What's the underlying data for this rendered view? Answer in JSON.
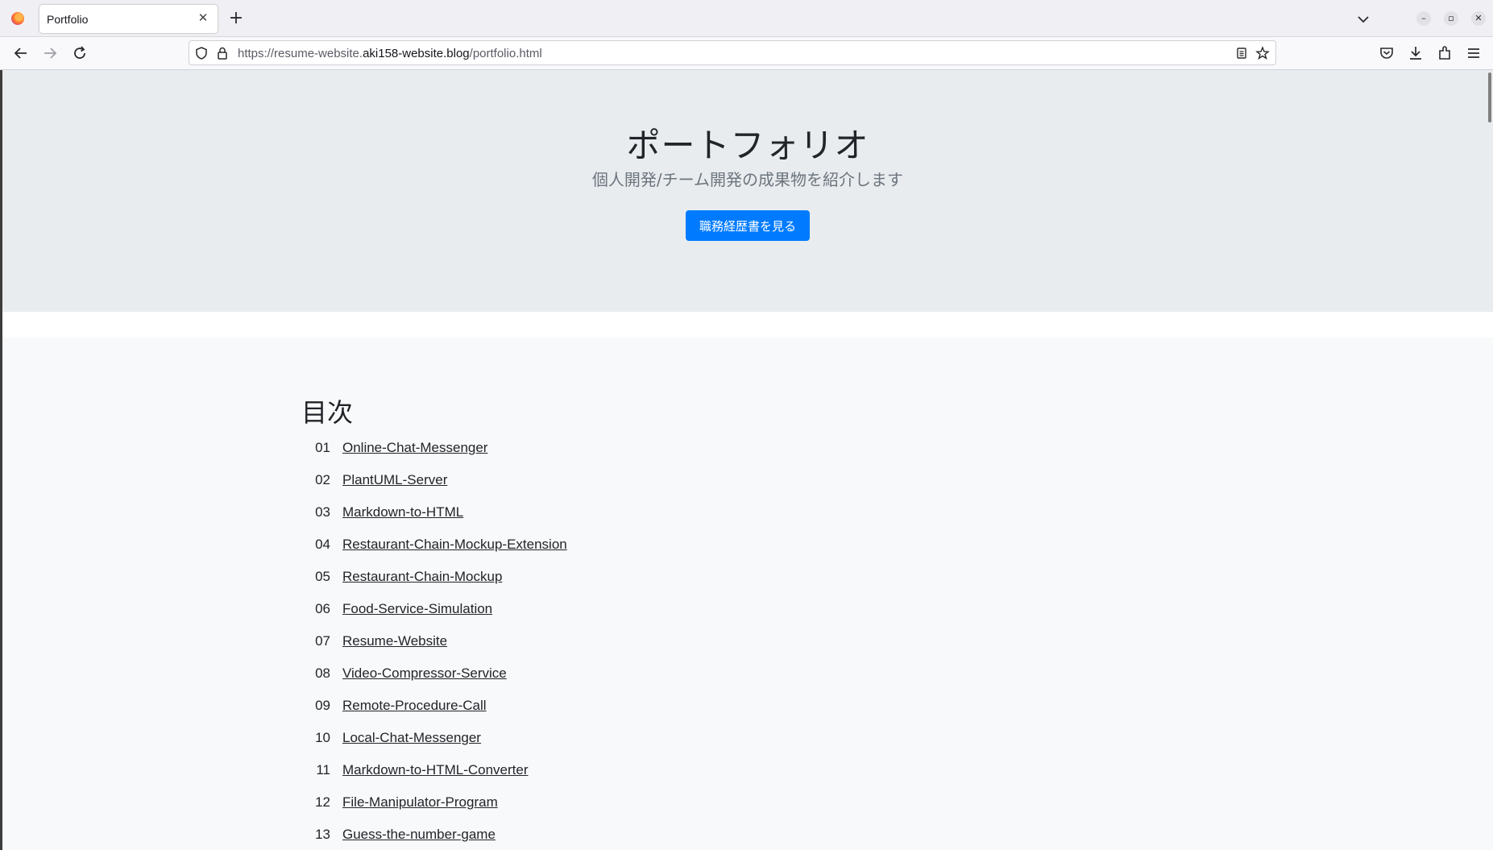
{
  "browser": {
    "tab_title": "Portfolio",
    "url_prefix": "https://resume-website.",
    "url_host": "aki158-website.blog",
    "url_path": "/portfolio.html",
    "icons": [
      "firefox-icon",
      "close-icon",
      "plus-icon",
      "chevron-down-icon",
      "minimize-icon",
      "restore-icon",
      "window-close-icon",
      "back-arrow-icon",
      "forward-arrow-icon",
      "reload-icon",
      "shield-icon",
      "lock-icon",
      "reader-view-icon",
      "bookmark-star-icon",
      "pocket-icon",
      "download-icon",
      "extensions-icon",
      "hamburger-menu-icon"
    ]
  },
  "hero": {
    "title": "ポートフォリオ",
    "subtitle": "個人開発/チーム開発の成果物を紹介します",
    "button_label": "職務経歴書を見る",
    "button_color": "#007bff"
  },
  "toc": {
    "heading": "目次",
    "items": [
      {
        "num": "01",
        "label": "Online-Chat-Messenger"
      },
      {
        "num": "02",
        "label": "PlantUML-Server"
      },
      {
        "num": "03",
        "label": "Markdown-to-HTML"
      },
      {
        "num": "04",
        "label": "Restaurant-Chain-Mockup-Extension"
      },
      {
        "num": "05",
        "label": "Restaurant-Chain-Mockup"
      },
      {
        "num": "06",
        "label": "Food-Service-Simulation"
      },
      {
        "num": "07",
        "label": "Resume-Website"
      },
      {
        "num": "08",
        "label": "Video-Compressor-Service"
      },
      {
        "num": "09",
        "label": "Remote-Procedure-Call"
      },
      {
        "num": "10",
        "label": "Local-Chat-Messenger"
      },
      {
        "num": "11",
        "label": "Markdown-to-HTML-Converter"
      },
      {
        "num": "12",
        "label": "File-Manipulator-Program"
      },
      {
        "num": "13",
        "label": "Guess-the-number-game"
      }
    ]
  }
}
